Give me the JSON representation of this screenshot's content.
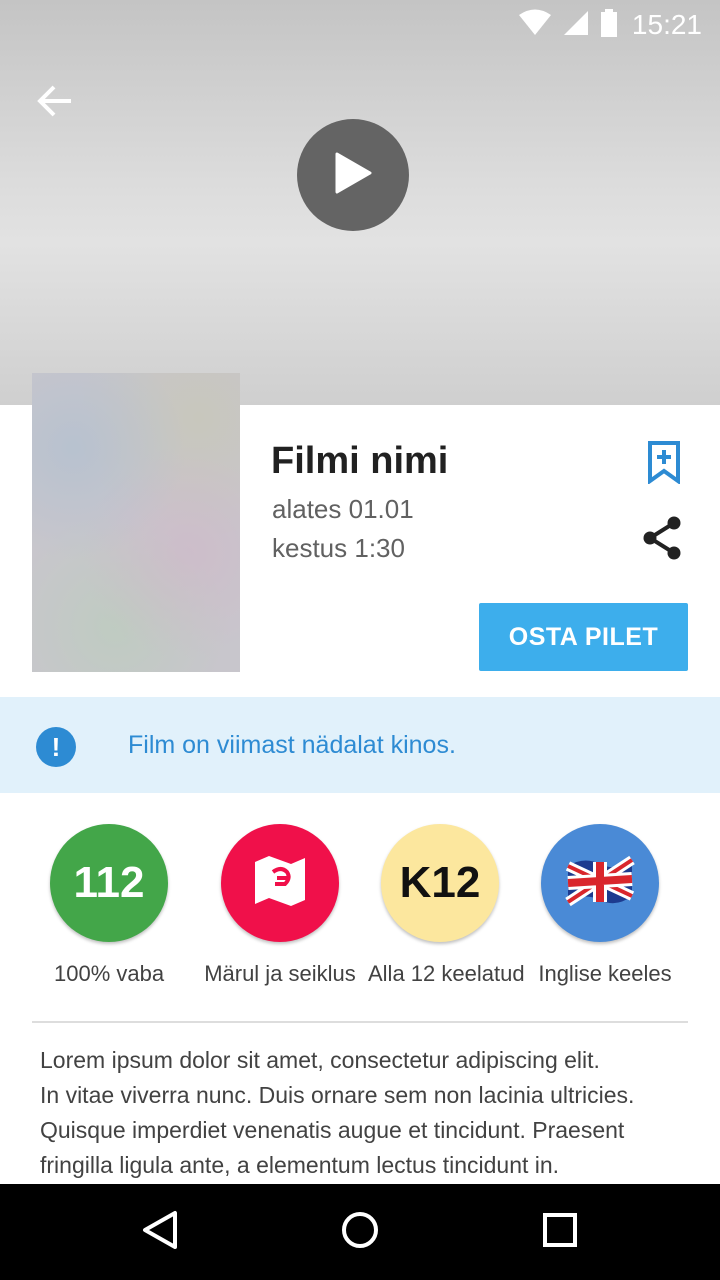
{
  "status_bar": {
    "time": "15:21"
  },
  "film": {
    "title": "Filmi nimi",
    "date": "alates 01.01",
    "duration": "kestus 1:30",
    "buy_label": "OSTA PILET"
  },
  "notice": {
    "icon_text": "!",
    "text": "Film on viimast nädalat kinos."
  },
  "badges": [
    {
      "text": "112",
      "label": "100% vaba",
      "color": "#43a649"
    },
    {
      "icon": "map-icon",
      "label": "Märul ja seiklus",
      "color": "#f0104a"
    },
    {
      "text": "K12",
      "label": "Alla 12 keelatud",
      "color": "#fce79e"
    },
    {
      "icon": "uk-flag-icon",
      "label": "Inglise keeles",
      "color": "#4a8ad6"
    }
  ],
  "description": {
    "line1": "Lorem ipsum dolor sit amet, consectetur adipiscing elit.",
    "line2": "In vitae viverra nunc. Duis ornare sem non lacinia ultricies. Quisque imperdiet venenatis augue et tincidunt. Praesent fringilla ligula ante, a elementum lectus tincidunt in."
  },
  "colors": {
    "accent": "#3daeec",
    "notice_bg": "#e1f1fb",
    "notice_text": "#2d8bd3"
  }
}
